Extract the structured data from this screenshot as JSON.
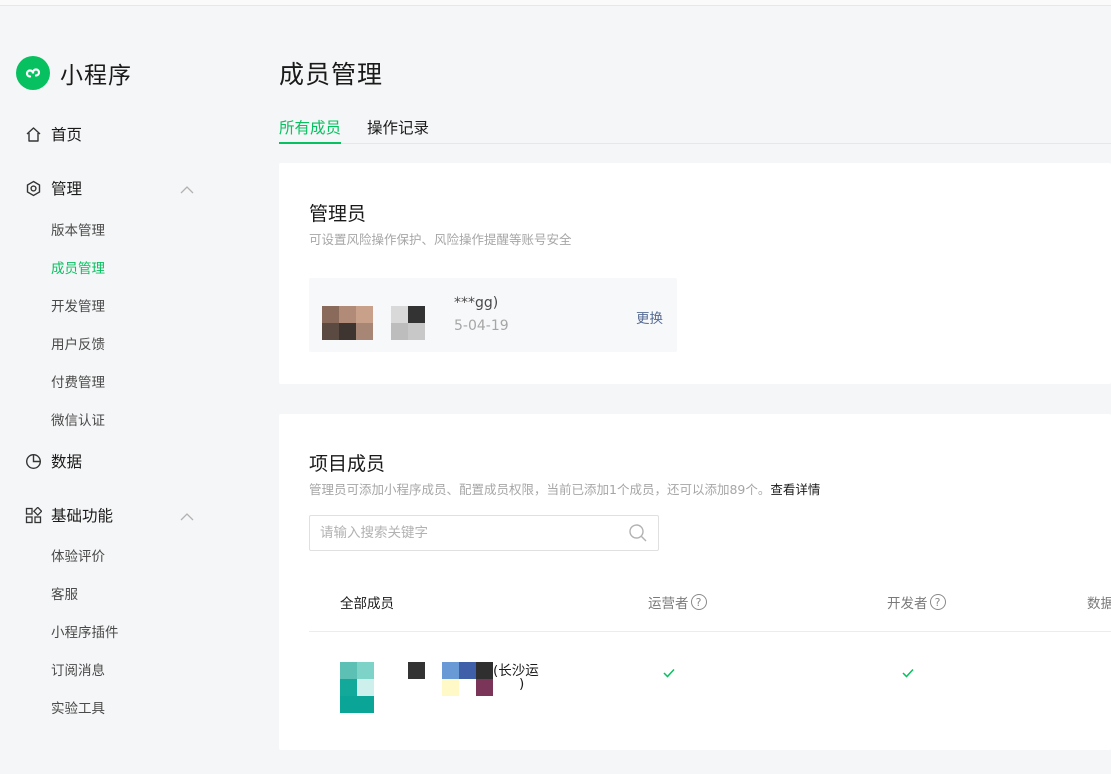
{
  "app": {
    "title": "小程序"
  },
  "sidebar": {
    "home": "首页",
    "manage": {
      "label": "管理",
      "items": [
        "版本管理",
        "成员管理",
        "开发管理",
        "用户反馈",
        "付费管理",
        "微信认证"
      ],
      "active": "成员管理"
    },
    "data": "数据",
    "basic": {
      "label": "基础功能",
      "items": [
        "体验评价",
        "客服",
        "小程序插件",
        "订阅消息",
        "实验工具"
      ]
    }
  },
  "page": {
    "title": "成员管理"
  },
  "tabs": [
    "所有成员",
    "操作记录"
  ],
  "admin_card": {
    "title": "管理员",
    "desc": "可设置风险操作保护、风险操作提醒等账号安全",
    "admin": {
      "name": "***gg)",
      "date": "5-04-19",
      "action": "更换"
    }
  },
  "members_card": {
    "title": "项目成员",
    "desc": "管理员可添加小程序成员、配置成员权限，当前已添加1个成员，还可以添加89个。",
    "desc_link": "查看详情",
    "search_placeholder": "请输入搜索关键字",
    "columns": [
      "全部成员",
      "运营者",
      "开发者",
      "数据"
    ],
    "rows": [
      {
        "name_line1": "(长沙运",
        "name_line2": ")",
        "operator": "✓",
        "developer": "✓"
      }
    ]
  },
  "colors": {
    "accent": "#07c160",
    "link": "#576b95"
  }
}
